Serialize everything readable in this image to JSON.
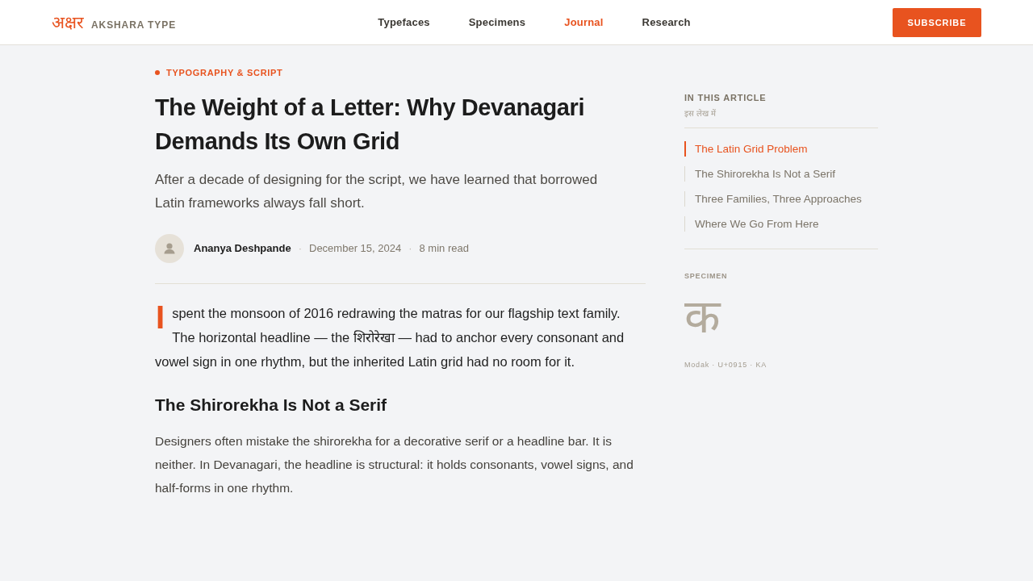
{
  "header": {
    "logo": {
      "mark": "अक्षर",
      "name": "AKSHARA TYPE"
    },
    "nav": [
      {
        "label": "Typefaces",
        "selected": false
      },
      {
        "label": "Specimens",
        "selected": false
      },
      {
        "label": "Journal",
        "selected": true
      },
      {
        "label": "Research",
        "selected": false
      }
    ],
    "subscribe_button": "SUBSCRIBE"
  },
  "article": {
    "category": "TYPOGRAPHY & SCRIPT",
    "title": "The Weight of a Letter: Why Devanagari Demands Its Own Grid",
    "subtitle": "After a decade of designing for the script, we have learned that borrowed Latin frameworks always fall short.",
    "byline": [
      {
        "kind": "author",
        "text": "Ananya Deshpande"
      },
      {
        "kind": "separator",
        "text": "·"
      },
      {
        "kind": "date",
        "text": "December 15, 2024"
      },
      {
        "kind": "separator",
        "text": "·"
      },
      {
        "kind": "read_time",
        "text": "8 min read"
      }
    ],
    "body": [
      {
        "kind": "lead",
        "text": "I spent the monsoon of 2016 redrawing the matras for our flagship text family. The horizontal headline — the शिरोरेखा — had to anchor every consonant and vowel sign in one rhythm, but the inherited Latin grid had no room for it."
      },
      {
        "kind": "heading",
        "text": "The Shirorekha Is Not a Serif"
      },
      {
        "kind": "paragraph",
        "text": "Designers often mistake the shirorekha for a decorative serif or a headline bar. It is neither. In Devanagari, the headline is structural: it holds consonants, vowel signs, and half-forms in one rhythm."
      }
    ]
  },
  "sidebar": {
    "toc_title": "IN THIS ARTICLE",
    "toc_subtitle": "इस लेख में",
    "toc": [
      {
        "label": "The Latin Grid Problem",
        "selected": true
      },
      {
        "label": "The Shirorekha Is Not a Serif",
        "selected": false
      },
      {
        "label": "Three Families, Three Approaches",
        "selected": false
      },
      {
        "label": "Where We Go From Here",
        "selected": false
      }
    ],
    "specimen": {
      "label": "SPECIMEN",
      "glyph": "क",
      "caption": "Modak · U+0915 · KA"
    }
  }
}
